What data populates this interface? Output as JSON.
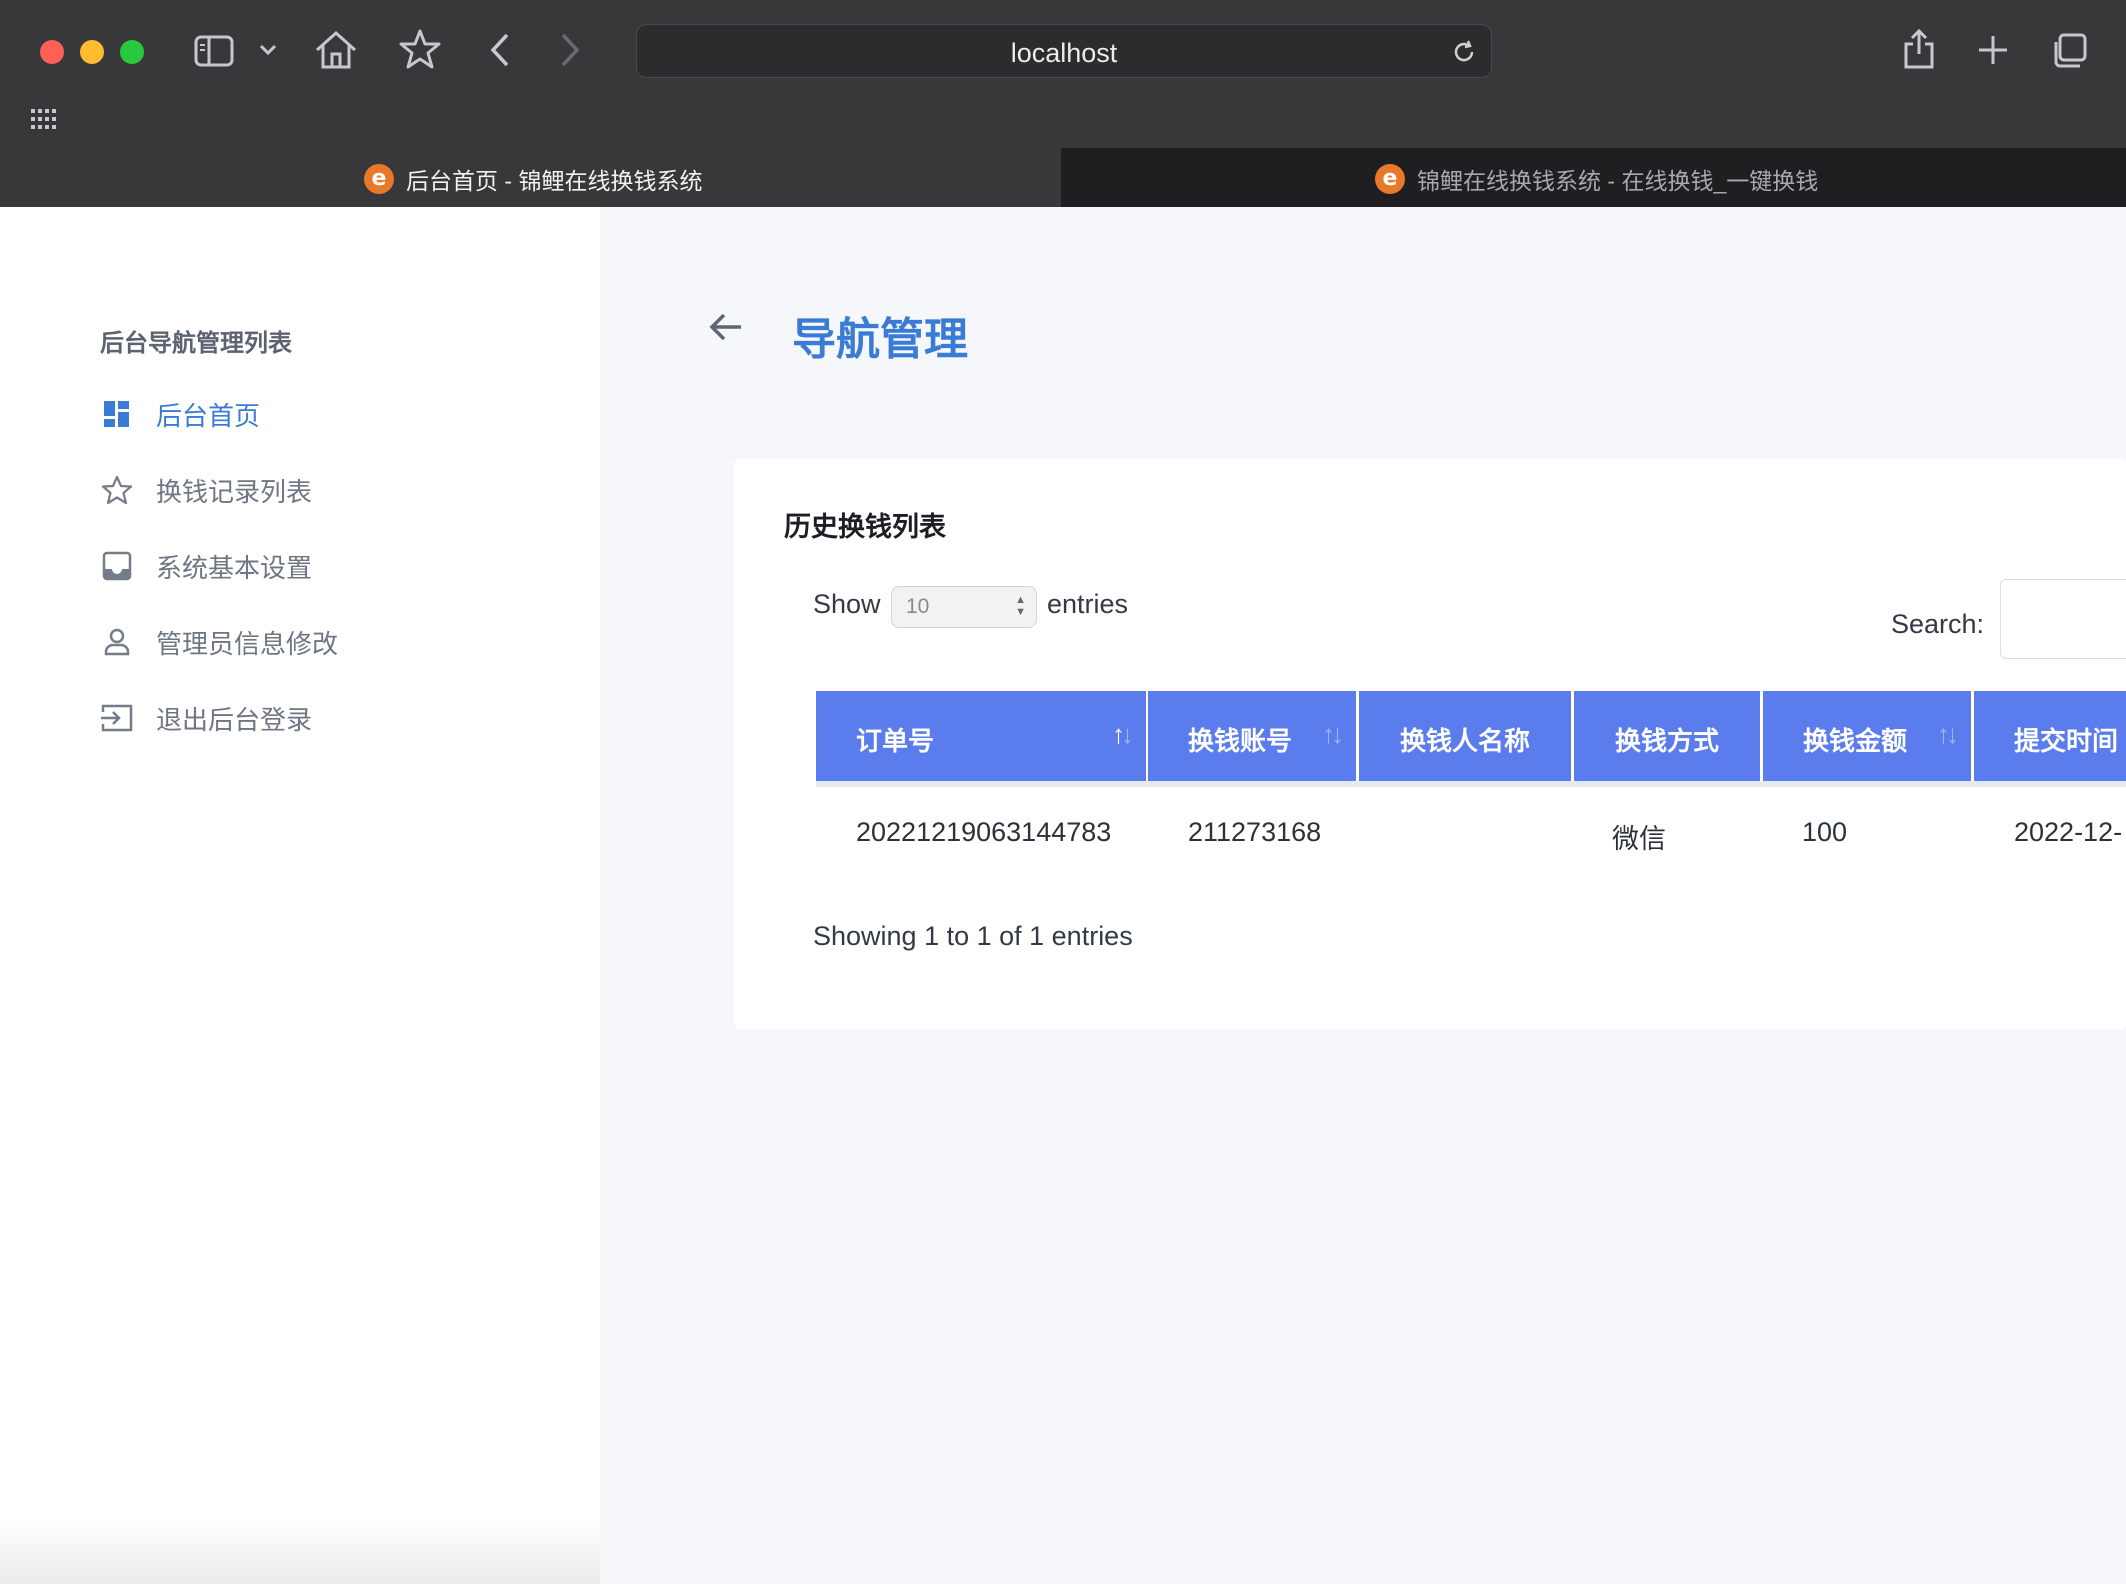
{
  "browser": {
    "url": "localhost",
    "tabs": [
      {
        "title": "后台首页 - 锦鲤在线换钱系统",
        "favicon": "e",
        "active": true
      },
      {
        "title": "锦鲤在线换钱系统 - 在线换钱_一键换钱",
        "favicon": "e",
        "active": false
      }
    ]
  },
  "sidebar": {
    "title": "后台导航管理列表",
    "items": [
      {
        "label": "后台首页",
        "icon": "dashboard-icon",
        "active": true
      },
      {
        "label": "换钱记录列表",
        "icon": "star-icon",
        "active": false
      },
      {
        "label": "系统基本设置",
        "icon": "inbox-icon",
        "active": false
      },
      {
        "label": "管理员信息修改",
        "icon": "user-icon",
        "active": false
      },
      {
        "label": "退出后台登录",
        "icon": "logout-icon",
        "active": false
      }
    ]
  },
  "main": {
    "page_title": "导航管理",
    "card": {
      "title": "历史换钱列表",
      "length": {
        "prefix": "Show",
        "value": "10",
        "suffix": "entries"
      },
      "search_label": "Search:",
      "columns": [
        "订单号",
        "换钱账号",
        "换钱人名称",
        "换钱方式",
        "换钱金额",
        "提交时间"
      ],
      "rows": [
        [
          "20221219063144783",
          "211273168",
          "",
          "微信",
          "100",
          "2022-12-"
        ]
      ],
      "info": "Showing 1 to 1 of 1 entries"
    }
  },
  "colors": {
    "accent": "#3a7bd5",
    "table_header": "#5b7cec",
    "main_bg": "#f5f7fb"
  }
}
